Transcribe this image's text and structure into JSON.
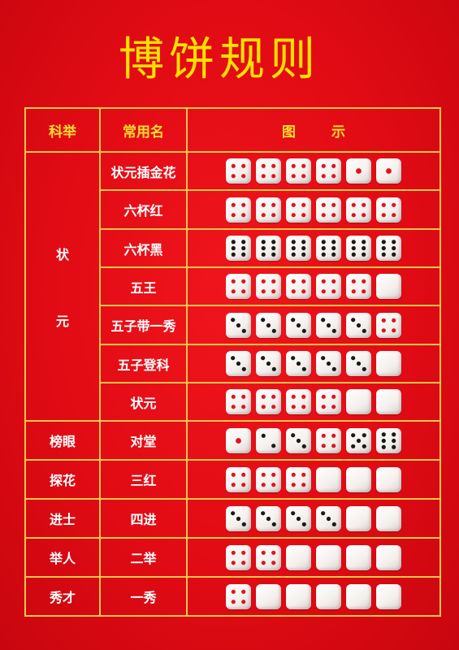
{
  "title": "博饼规则",
  "headers": {
    "keju": "科举",
    "name": "常用名",
    "diagram": "图示"
  },
  "groups": [
    {
      "keju_lines": [
        "状",
        "元"
      ],
      "rows": [
        {
          "name": "状元插金花",
          "dice": [
            4,
            4,
            4,
            4,
            1,
            1
          ]
        },
        {
          "name": "六杯红",
          "dice": [
            4,
            4,
            4,
            4,
            4,
            4
          ]
        },
        {
          "name": "六杯黑",
          "dice": [
            6,
            6,
            6,
            6,
            6,
            6
          ]
        },
        {
          "name": "五王",
          "dice": [
            4,
            4,
            4,
            4,
            4,
            0
          ]
        },
        {
          "name": "五子带一秀",
          "dice": [
            3,
            3,
            3,
            3,
            3,
            4
          ]
        },
        {
          "name": "五子登科",
          "dice": [
            3,
            3,
            3,
            3,
            3,
            0
          ]
        },
        {
          "name": "状元",
          "dice": [
            4,
            4,
            4,
            4,
            0,
            0
          ]
        }
      ]
    },
    {
      "keju_lines": [
        "榜眼"
      ],
      "rows": [
        {
          "name": "对堂",
          "dice": [
            1,
            2,
            3,
            4,
            5,
            6
          ]
        }
      ]
    },
    {
      "keju_lines": [
        "探花"
      ],
      "rows": [
        {
          "name": "三红",
          "dice": [
            4,
            4,
            4,
            0,
            0,
            0
          ]
        }
      ]
    },
    {
      "keju_lines": [
        "进士"
      ],
      "rows": [
        {
          "name": "四进",
          "dice": [
            3,
            3,
            3,
            3,
            0,
            0
          ]
        }
      ]
    },
    {
      "keju_lines": [
        "举人"
      ],
      "rows": [
        {
          "name": "二举",
          "dice": [
            4,
            4,
            0,
            0,
            0,
            0
          ]
        }
      ]
    },
    {
      "keju_lines": [
        "秀才"
      ],
      "rows": [
        {
          "name": "一秀",
          "dice": [
            4,
            0,
            0,
            0,
            0,
            0
          ]
        }
      ]
    }
  ],
  "colors": {
    "background": "#e10b14",
    "title": "#ffe100",
    "border": "#f7c64a",
    "header_text": "#ffde2e",
    "pip": "#e3121b"
  }
}
